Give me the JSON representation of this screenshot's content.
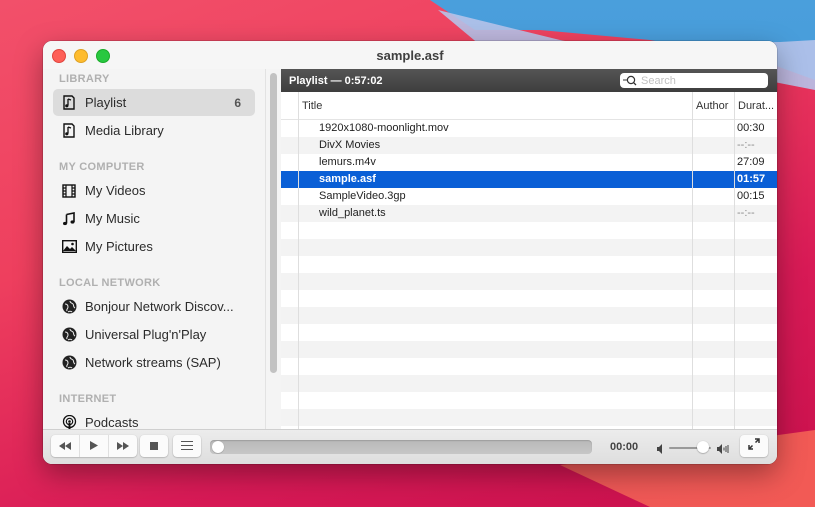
{
  "window": {
    "title": "sample.asf"
  },
  "sidebar": {
    "sections": [
      {
        "heading": "LIBRARY",
        "items": [
          {
            "label": "Playlist",
            "icon": "playlist-icon",
            "count": "6",
            "selected": true
          },
          {
            "label": "Media Library",
            "icon": "media-library-icon"
          }
        ]
      },
      {
        "heading": "MY COMPUTER",
        "items": [
          {
            "label": "My Videos",
            "icon": "film-icon"
          },
          {
            "label": "My Music",
            "icon": "music-note-icon"
          },
          {
            "label": "My Pictures",
            "icon": "picture-icon"
          }
        ]
      },
      {
        "heading": "LOCAL NETWORK",
        "items": [
          {
            "label": "Bonjour Network Discov...",
            "icon": "globe-icon"
          },
          {
            "label": "Universal Plug'n'Play",
            "icon": "globe-icon"
          },
          {
            "label": "Network streams (SAP)",
            "icon": "globe-icon"
          }
        ]
      },
      {
        "heading": "INTERNET",
        "items": [
          {
            "label": "Podcasts",
            "icon": "podcast-icon"
          }
        ]
      }
    ]
  },
  "playlist": {
    "header": "Playlist — 0:57:02",
    "search_placeholder": "Search",
    "search_value": "",
    "columns": [
      "Title",
      "Author",
      "Durat..."
    ],
    "rows": [
      {
        "title": "1920x1080-moonlight.mov",
        "author": "",
        "duration": "00:30"
      },
      {
        "title": "DivX Movies",
        "author": "",
        "duration": "--:--"
      },
      {
        "title": "lemurs.m4v",
        "author": "",
        "duration": "27:09"
      },
      {
        "title": "sample.asf",
        "author": "",
        "duration": "01:57",
        "selected": true
      },
      {
        "title": "SampleVideo.3gp",
        "author": "",
        "duration": "00:15"
      },
      {
        "title": "wild_planet.ts",
        "author": "",
        "duration": "--:--"
      }
    ]
  },
  "controls": {
    "time": "00:00",
    "progress": 0,
    "volume": 0.8,
    "buttons": [
      "rewind",
      "play",
      "fast-forward",
      "stop",
      "toggle-playlist",
      "fullscreen"
    ]
  },
  "colors": {
    "selection": "#0a5fd6",
    "close": "#fe5f57",
    "minimize": "#febc2e",
    "maximize": "#28c840"
  }
}
